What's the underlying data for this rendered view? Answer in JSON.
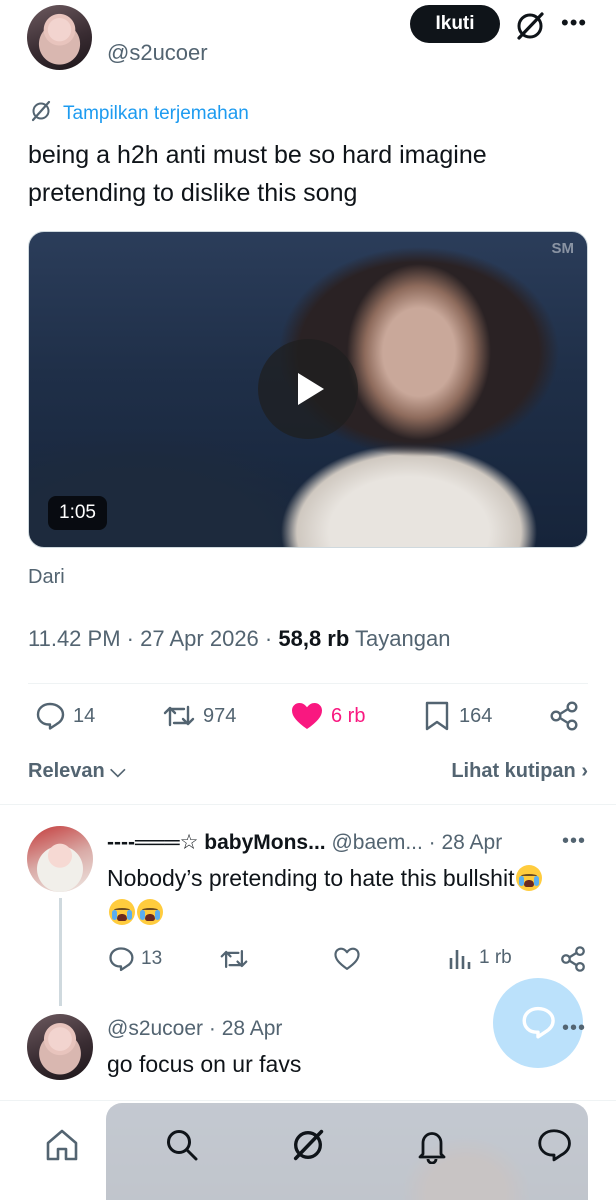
{
  "header": {
    "handle": "@s2ucoer",
    "follow_label": "Ikuti"
  },
  "tweet": {
    "translate_label": "Tampilkan terjemahan",
    "text": "being a h2h anti must be so hard imagine pretending to dislike this song",
    "video": {
      "duration": "1:05",
      "watermark": "SM"
    },
    "source_label": "Dari",
    "time": "11.42 PM",
    "date": "27 Apr 2026",
    "views_count": "58,8 rb",
    "views_label": "Tayangan",
    "stats": {
      "replies": "14",
      "retweets": "974",
      "likes": "6 rb",
      "bookmarks": "164"
    },
    "colors": {
      "like_active": "#f91880",
      "link": "#1d9bf0",
      "muted": "#536471"
    }
  },
  "sort": {
    "relevance_label": "Relevan",
    "quotes_label": "Lihat kutipan"
  },
  "replies": [
    {
      "name": "----═══☆ babyMons...",
      "handle": "@baem...",
      "date": "28 Apr",
      "text": "Nobody’s pretending to hate this bullshit",
      "stats": {
        "replies": "13",
        "views": "1 rb"
      }
    },
    {
      "handle": "@s2ucoer",
      "date": "28 Apr",
      "text": "go focus on ur favs"
    }
  ],
  "nav": {
    "items": [
      "home-icon",
      "search-icon",
      "grok-icon",
      "notifications-icon",
      "messages-icon"
    ]
  }
}
